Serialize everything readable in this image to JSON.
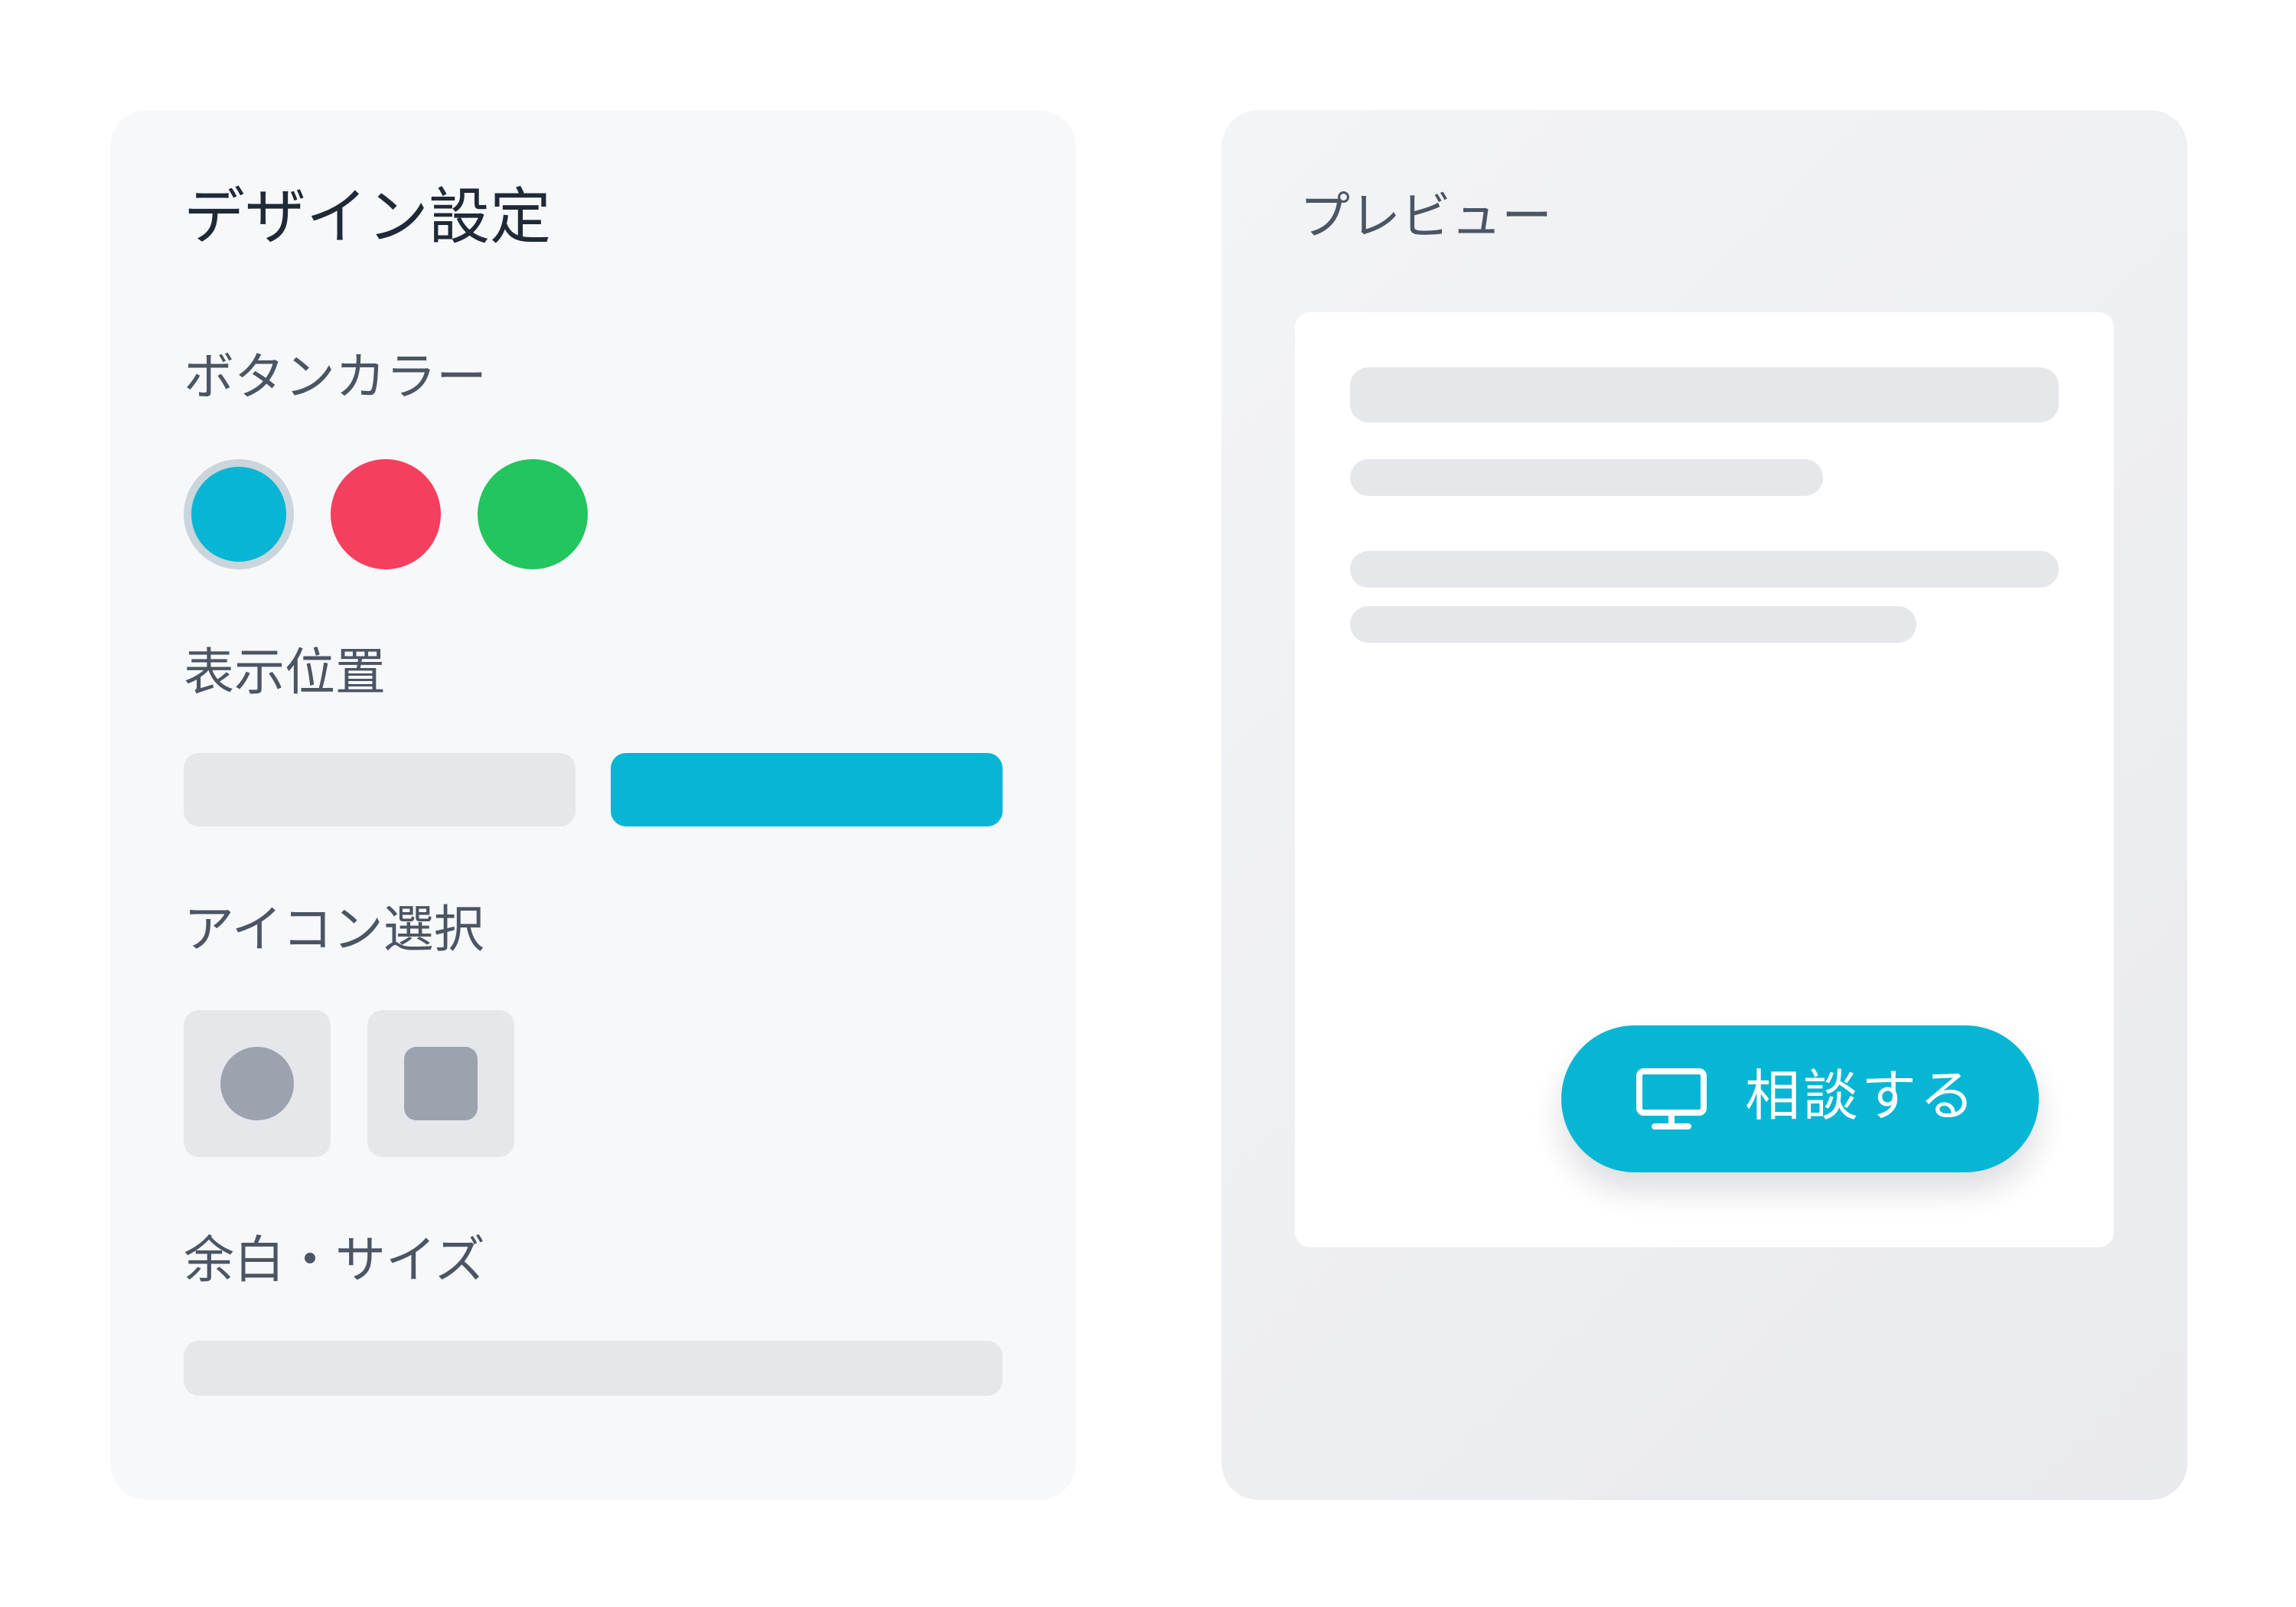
{
  "settings": {
    "title": "デザイン設定",
    "button_color": {
      "label": "ボタンカラー",
      "options": [
        {
          "name": "cyan",
          "color": "#06b6d4",
          "selected": true
        },
        {
          "name": "red",
          "color": "#f43f5e",
          "selected": false
        },
        {
          "name": "green",
          "color": "#22c55e",
          "selected": false
        }
      ]
    },
    "position": {
      "label": "表示位置",
      "options": [
        {
          "name": "left",
          "selected": false
        },
        {
          "name": "right",
          "selected": true
        }
      ]
    },
    "icon": {
      "label": "アイコン選択",
      "options": [
        {
          "name": "circle-icon",
          "selected": false
        },
        {
          "name": "square-icon",
          "selected": false
        }
      ]
    },
    "spacing_size": {
      "label": "余白・サイズ"
    }
  },
  "preview": {
    "title": "プレビュー",
    "cta": {
      "label": "相談する",
      "icon": "monitor-icon",
      "color": "#06b6d4"
    }
  },
  "colors": {
    "accent": "#06b6d4",
    "panel_bg": "#f7f8fa",
    "placeholder": "#e5e7eb"
  }
}
